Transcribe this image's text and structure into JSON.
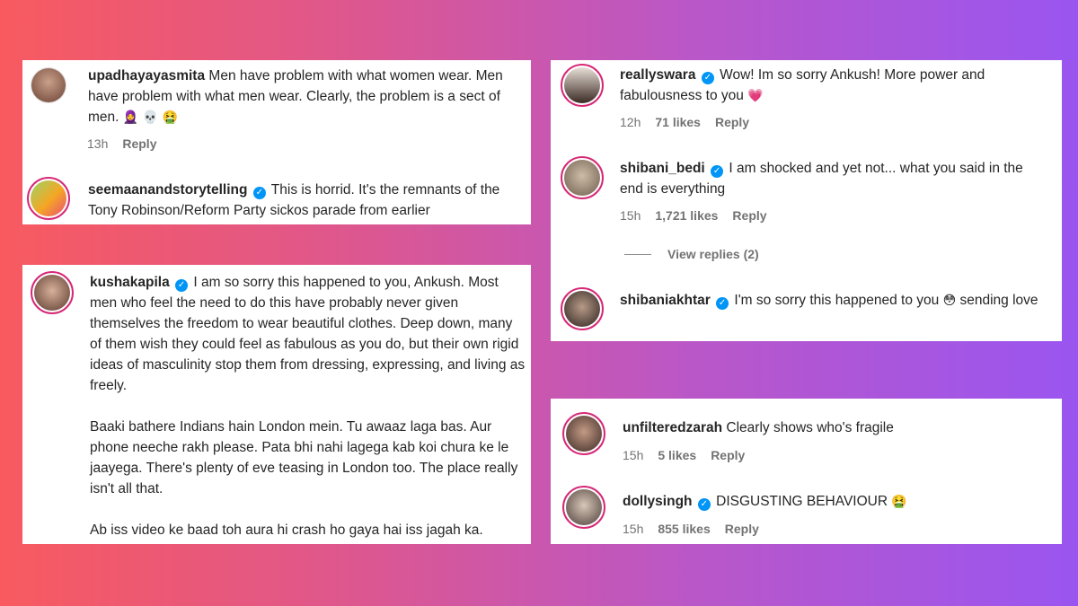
{
  "cards": {
    "top_left": {
      "c1": {
        "username": "upadhayayasmita",
        "text": "Men have problem with what women wear. Men have problem with what men wear. Clearly, the problem is a sect of men.",
        "emojis": "🧕 💀 🤮",
        "time": "13h",
        "reply": "Reply"
      },
      "c2": {
        "username": "seemaanandstorytelling",
        "text": "This is horrid. It's the remnants of the Tony Robinson/Reform Party sickos parade from earlier"
      }
    },
    "bottom_left": {
      "c1": {
        "username": "kushakapila",
        "p1": "I am so sorry this happened to you, Ankush. Most men who feel the need to do this have probably never given themselves the freedom to wear beautiful clothes. Deep down, many of them wish they could feel as fabulous as you do, but their own rigid ideas of masculinity stop them from dressing, expressing, and living as freely.",
        "p2": "Baaki bathere Indians hain London mein. Tu awaaz laga bas. Aur phone neeche rakh please. Pata bhi nahi lagega kab koi chura ke le jaayega. There's plenty of eve teasing in London too. The place really isn't all that.",
        "p3": "Ab iss video ke baad toh aura hi crash ho gaya hai iss jagah ka."
      }
    },
    "top_right": {
      "c1": {
        "username": "reallyswara",
        "text": "Wow! Im so sorry Ankush! More power and fabulousness to you",
        "emoji": "💗",
        "time": "12h",
        "likes": "71 likes",
        "reply": "Reply"
      },
      "c2": {
        "username": "shibani_bedi",
        "text": "I am shocked and yet not... what you said in the end is everything",
        "time": "15h",
        "likes": "1,721 likes",
        "reply": "Reply"
      },
      "view_replies": "View replies (2)",
      "c3": {
        "username": "shibaniakhtar",
        "text": "I'm so sorry this happened to you",
        "emoji": "😳",
        "text2": "sending love"
      }
    },
    "bottom_right": {
      "c1": {
        "username": "unfilteredzarah",
        "text": "Clearly shows who's fragile",
        "time": "15h",
        "likes": "5 likes",
        "reply": "Reply"
      },
      "c2": {
        "username": "dollysingh",
        "text": "DISGUSTING BEHAVIOUR",
        "emoji": "🤮",
        "time": "15h",
        "likes": "855 likes",
        "reply": "Reply"
      }
    }
  },
  "colors": {
    "verified": "#0095f6",
    "story_ring": "#d62976",
    "muted": "#737373"
  }
}
